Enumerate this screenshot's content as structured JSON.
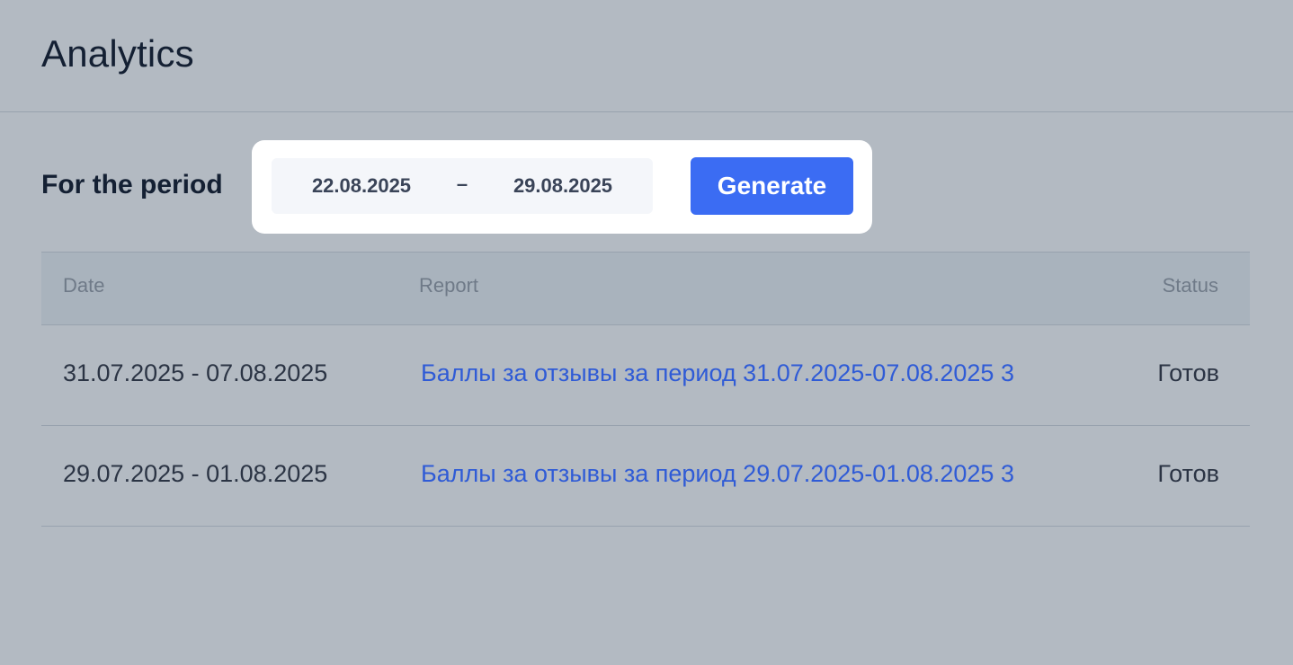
{
  "header": {
    "title": "Analytics"
  },
  "period": {
    "label": "For the period",
    "date_from": "22.08.2025",
    "separator": "–",
    "date_to": "29.08.2025",
    "generate_label": "Generate"
  },
  "table": {
    "columns": [
      "Date",
      "Report",
      "Status"
    ],
    "rows": [
      {
        "date": "31.07.2025 - 07.08.2025",
        "report": "Баллы за отзывы за период 31.07.2025-07.08.2025 3",
        "status": "Готов"
      },
      {
        "date": "29.07.2025 - 01.08.2025",
        "report": "Баллы за отзывы за период 29.07.2025-01.08.2025 3",
        "status": "Готов"
      }
    ]
  },
  "colors": {
    "background": "#b3bac2",
    "accent": "#3b6cf3",
    "link": "#2f5bd6"
  }
}
